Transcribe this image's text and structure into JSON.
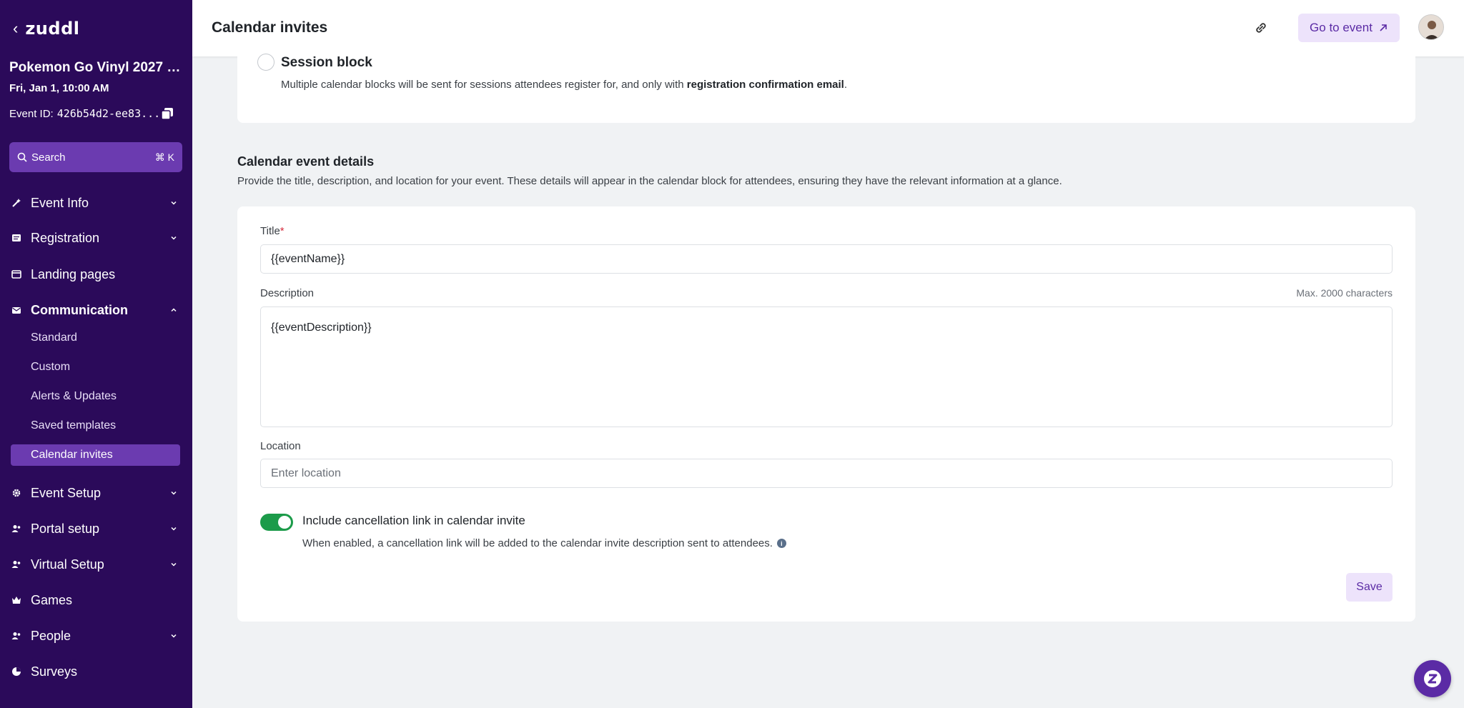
{
  "sidebar": {
    "logo": "zuddl",
    "event_name": "Pokemon Go Vinyl 2027 e...",
    "event_date": "Fri, Jan 1, 10:00 AM",
    "event_id_label": "Event ID:",
    "event_id_value": "426b54d2-ee83...",
    "search": {
      "label": "Search",
      "shortcut": "⌘ K"
    },
    "nav": [
      {
        "label": "Event Info",
        "icon": "magic-wand-icon",
        "expandable": true
      },
      {
        "label": "Registration",
        "icon": "form-icon",
        "expandable": true
      },
      {
        "label": "Landing pages",
        "icon": "browser-window-icon",
        "expandable": false
      },
      {
        "label": "Communication",
        "icon": "mail-icon",
        "expandable": true,
        "expanded": true
      },
      {
        "label": "Event Setup",
        "icon": "gear-icon",
        "expandable": true
      },
      {
        "label": "Portal setup",
        "icon": "users-icon",
        "expandable": true
      },
      {
        "label": "Virtual Setup",
        "icon": "users-icon",
        "expandable": true
      },
      {
        "label": "Games",
        "icon": "crown-icon",
        "expandable": false
      },
      {
        "label": "People",
        "icon": "users-icon",
        "expandable": true
      },
      {
        "label": "Surveys",
        "icon": "pie-chart-icon",
        "expandable": false
      }
    ],
    "communication_sub": [
      {
        "label": "Standard"
      },
      {
        "label": "Custom"
      },
      {
        "label": "Alerts & Updates"
      },
      {
        "label": "Saved templates"
      },
      {
        "label": "Calendar invites",
        "active": true
      }
    ]
  },
  "header": {
    "title": "Calendar invites",
    "goto_label": "Go to event"
  },
  "session_block": {
    "title": "Session block",
    "desc_pre": "Multiple calendar blocks will be sent for sessions attendees register for, and only with ",
    "desc_bold": "registration confirmation email",
    "desc_post": "."
  },
  "details": {
    "title": "Calendar event details",
    "desc": "Provide the title, description, and location for your event. These details will appear in the calendar block for attendees, ensuring they have the relevant information at a glance.",
    "title_label": "Title",
    "title_required": "*",
    "title_value": "{{eventName}}",
    "description_label": "Description",
    "description_max": "Max. 2000 characters",
    "description_value": "{{eventDescription}}",
    "location_label": "Location",
    "location_placeholder": "Enter location",
    "toggle_label": "Include cancellation link in calendar invite",
    "toggle_on": true,
    "toggle_desc": "When enabled, a cancellation link will be added to the calendar invite description sent to attendees.",
    "save_label": "Save"
  },
  "colors": {
    "sidebar_bg": "#2b0a5a",
    "accent": "#6b3bb0",
    "toggle_on": "#1c9b4a"
  }
}
